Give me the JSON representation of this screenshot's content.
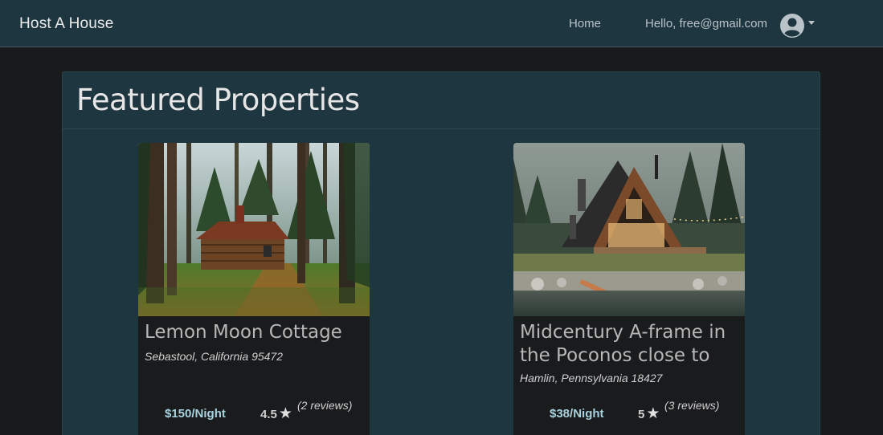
{
  "navbar": {
    "brand": "Host A House",
    "home_label": "Home",
    "user_greeting": "Hello, free@gmail.com"
  },
  "main": {
    "title": "Featured Properties",
    "properties": [
      {
        "title": "Lemon Moon Cottage",
        "location": "Sebastool, California 95472",
        "price": "$150/Night",
        "rating": "4.5",
        "reviews": "(2 reviews)"
      },
      {
        "title": "Midcentury A-frame in the Poconos close to",
        "location": "Hamlin, Pennsylvania 18427",
        "price": "$38/Night",
        "rating": "5",
        "reviews": "(3 reviews)"
      }
    ]
  },
  "colors": {
    "navbar_bg": "#1e3640",
    "page_bg": "#191a1c",
    "card_bg": "#1a1b1d",
    "price_accent": "#a8d3de"
  },
  "icons": {
    "user": "user-circle-icon",
    "caret": "caret-down-icon",
    "star": "star-icon"
  }
}
